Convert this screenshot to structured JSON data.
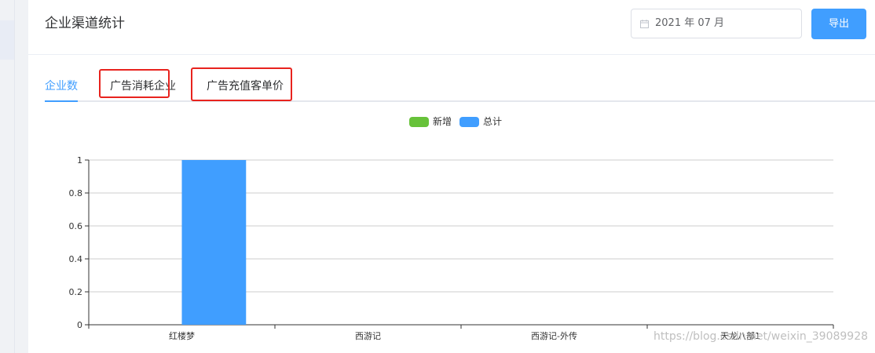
{
  "header": {
    "title": "企业渠道统计",
    "date_value": "2021 年 07 月",
    "export_label": "导出"
  },
  "tabs": [
    {
      "label": "企业数",
      "active": true
    },
    {
      "label": "广告消耗企业",
      "active": false
    },
    {
      "label": "广告充值客单价",
      "active": false
    }
  ],
  "colors": {
    "primary": "#409eff",
    "new_series": "#67c23a",
    "total_series": "#409eff",
    "annotation_box": "#e8231e"
  },
  "watermark": "https://blog.csdn.net/weixin_39089928",
  "chart_data": {
    "type": "bar",
    "categories": [
      "红楼梦",
      "西游记",
      "西游记-外传",
      "天龙八部1"
    ],
    "series": [
      {
        "name": "新增",
        "values": [
          0,
          0,
          0,
          0
        ],
        "color": "#67c23a"
      },
      {
        "name": "总计",
        "values": [
          1,
          0,
          0,
          0
        ],
        "color": "#409eff"
      }
    ],
    "yticks": [
      "0",
      "0.2",
      "0.4",
      "0.6",
      "0.8",
      "1"
    ],
    "ylim": [
      0,
      1
    ],
    "grid": true,
    "legend_position": "top-center"
  }
}
